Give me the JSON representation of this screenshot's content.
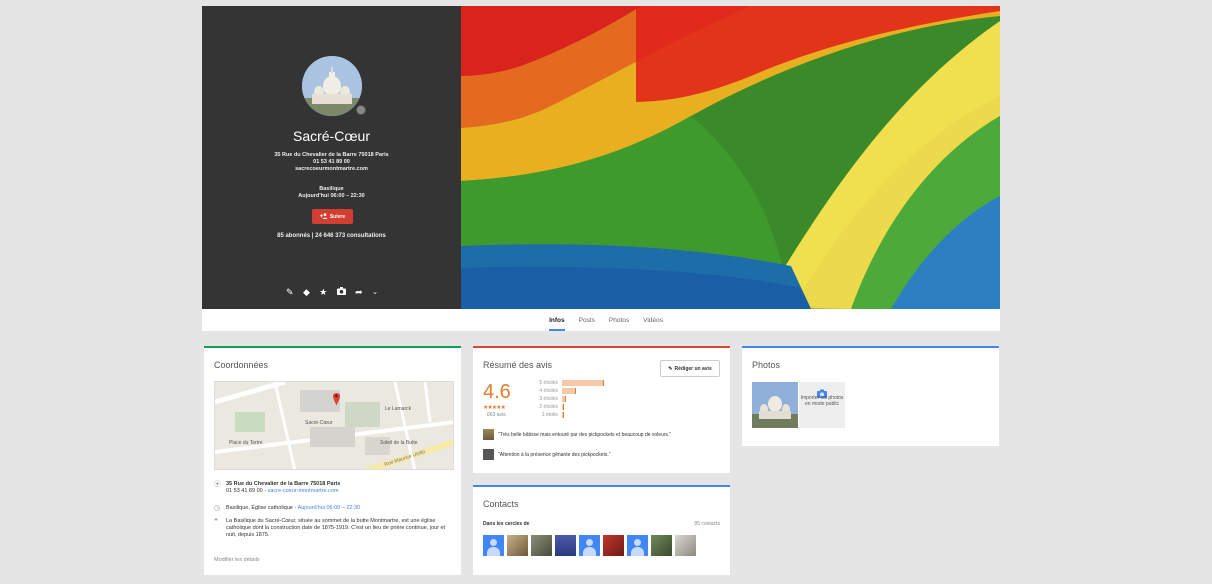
{
  "profile": {
    "name": "Sacré-Cœur",
    "address": "35 Rue du Chevalier de la Barre 75018 Paris",
    "phone": "01 53 41 89 00",
    "website": "sacrecoeurmontmartre.com",
    "category": "Basilique",
    "hours": "Aujourd'hui 06:00 – 22:30",
    "follow_label": "Suivre",
    "stats": "85 abonnés | 24 646 373 consultations"
  },
  "tabs": [
    {
      "label": "Infos",
      "active": true
    },
    {
      "label": "Posts",
      "active": false
    },
    {
      "label": "Photos",
      "active": false
    },
    {
      "label": "Vidéos",
      "active": false
    }
  ],
  "coords": {
    "title": "Coordonnées",
    "map_labels": [
      "Sacré-Cœur",
      "Place du Tertre",
      "Le Lamarck",
      "Soleil de la Butte",
      "Rue Maurice Utrillo"
    ],
    "address": "35 Rue du Chevalier de la Barre 75018 Paris",
    "phone": "01 53 41 89 00",
    "website": "sacre-coeur-montmartre.com",
    "category": "Basilique, Église catholique",
    "hours": "Aujourd'hui 06:00 – 22:30",
    "description": "La Basilique du Sacré-Cœur, située au sommet de la butte Montmartre, est une église catholique dont la construction date de 1875-1919. C'est un lieu de prière continue, jour et nuit, depuis 1875.",
    "edit_label": "Modifier les détails"
  },
  "reviews": {
    "title": "Résumé des avis",
    "write_label": "Rédiger un avis",
    "rating": "4.6",
    "stars": "★★★★★",
    "count": "663 avis",
    "distribution": [
      {
        "label": "5 étoiles",
        "fraction": 1.0
      },
      {
        "label": "4 étoiles",
        "fraction": 0.34
      },
      {
        "label": "3 étoiles",
        "fraction": 0.1
      },
      {
        "label": "2 étoiles",
        "fraction": 0.03
      },
      {
        "label": "1 étoile",
        "fraction": 0.03
      }
    ],
    "quotes": [
      "\"Très belle bâtisse mais entouré par des pickpockets et beaucoup de voleurs.\"",
      "\"Attention à la présence gênante des pickpockets.\""
    ]
  },
  "contacts": {
    "title": "Contacts",
    "circles_label": "Dans les cercles de",
    "count": "85 contacts"
  },
  "photos": {
    "title": "Photos",
    "import_label": "Importer les photos en mode public"
  },
  "colors": {
    "brand_red": "#d23f31",
    "link_blue": "#4285f4",
    "rating_orange": "#e67c2e"
  }
}
